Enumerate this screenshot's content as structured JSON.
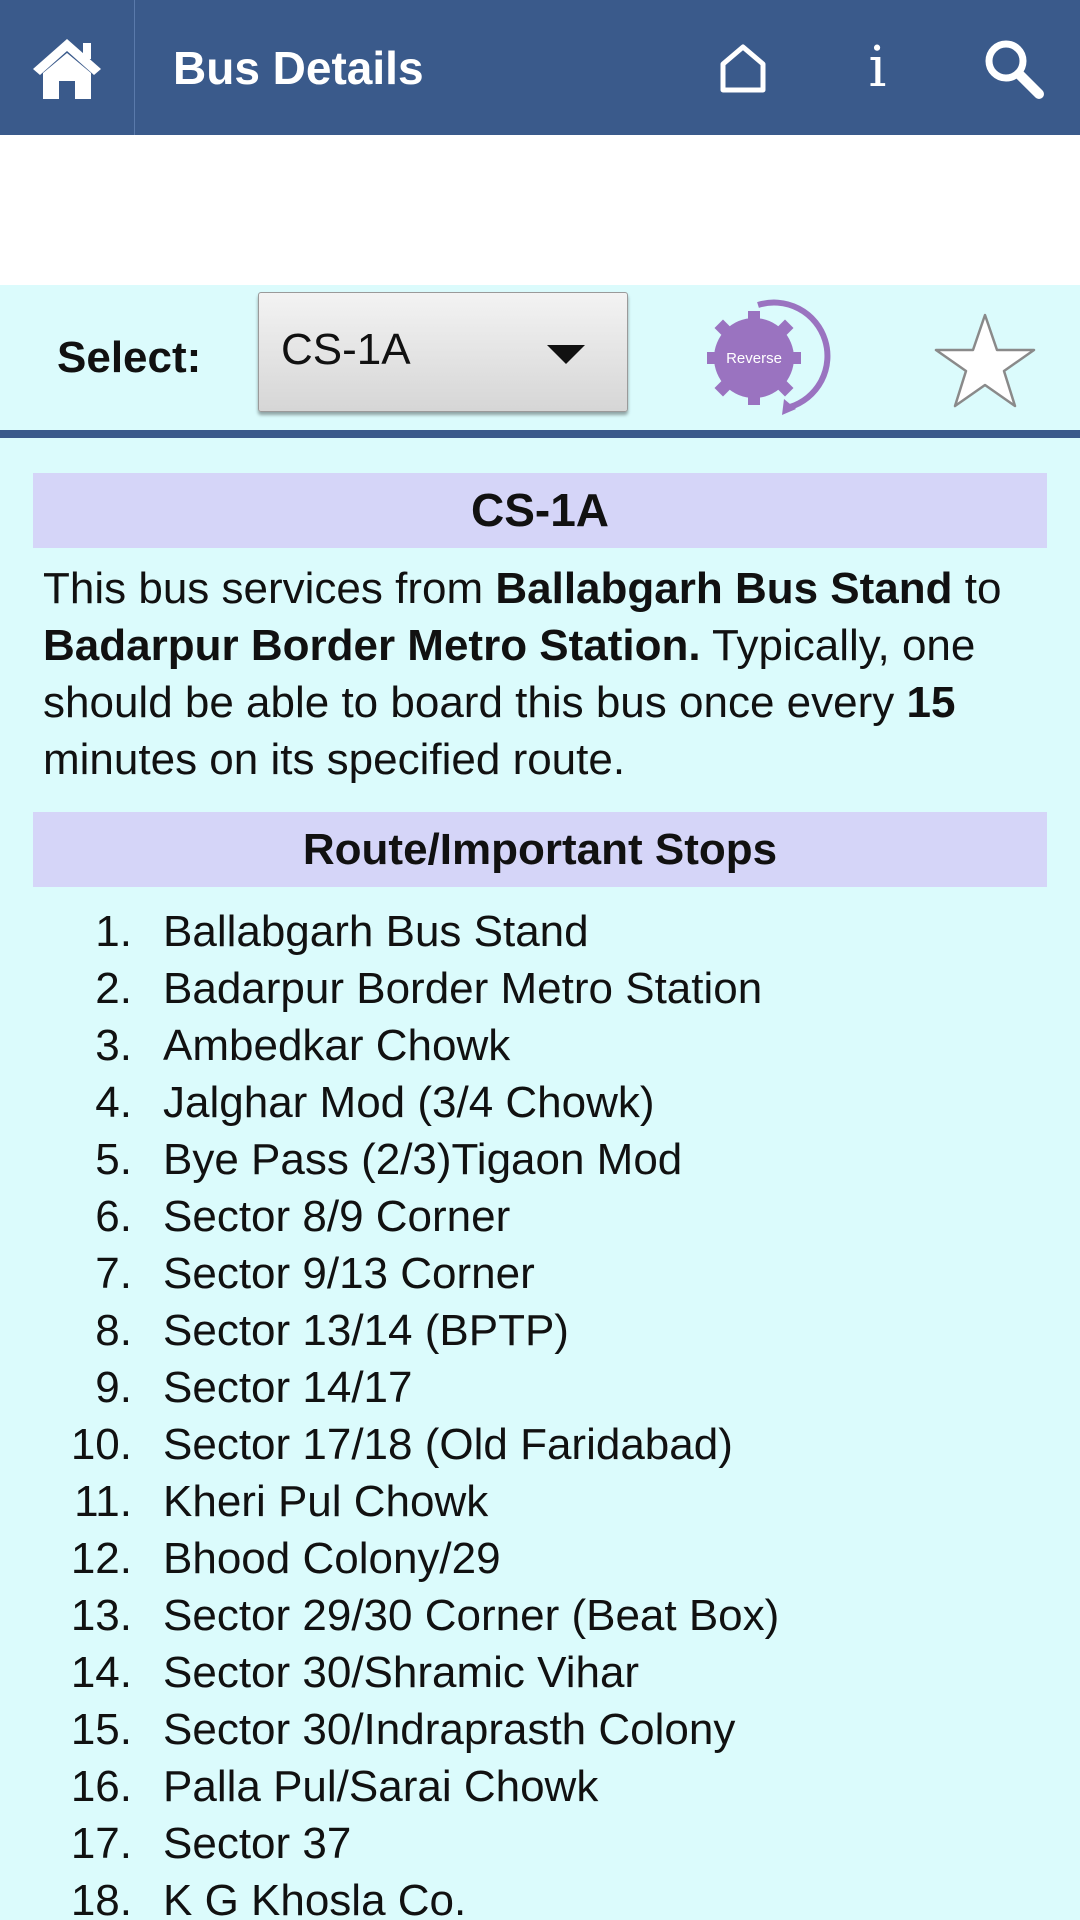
{
  "topbar": {
    "title": "Bus Details",
    "icons": [
      "home-icon",
      "house-outline-icon",
      "info-icon",
      "search-icon"
    ],
    "info_glyph": "i"
  },
  "selector": {
    "label": "Select:",
    "value": "CS-1A",
    "reverse_label": "Reverse"
  },
  "route": {
    "title": "CS-1A",
    "desc": {
      "p1": "This bus services from ",
      "from": "Ballabgarh Bus Stand",
      "p2": " to ",
      "to": "Badarpur Border Metro Station.",
      "p3": " Typically, one should be able to board this bus once every ",
      "freq": "15",
      "p4": " minutes on its specified route."
    },
    "stops_header": "Route/Important Stops",
    "stops": [
      {
        "num": "1.",
        "name": "Ballabgarh Bus Stand"
      },
      {
        "num": "2.",
        "name": "Badarpur Border Metro Station"
      },
      {
        "num": "3.",
        "name": "Ambedkar Chowk"
      },
      {
        "num": "4.",
        "name": "Jalghar Mod (3/4 Chowk)"
      },
      {
        "num": "5.",
        "name": "Bye Pass (2/3)Tigaon Mod"
      },
      {
        "num": "6.",
        "name": "Sector 8/9 Corner"
      },
      {
        "num": "7.",
        "name": "Sector 9/13 Corner"
      },
      {
        "num": "8.",
        "name": "Sector 13/14 (BPTP)"
      },
      {
        "num": "9.",
        "name": "Sector 14/17"
      },
      {
        "num": "10.",
        "name": "Sector 17/18 (Old Faridabad)"
      },
      {
        "num": "11.",
        "name": "Kheri Pul Chowk"
      },
      {
        "num": "12.",
        "name": "Bhood Colony/29"
      },
      {
        "num": "13.",
        "name": "Sector 29/30 Corner (Beat Box)"
      },
      {
        "num": "14.",
        "name": "Sector 30/Shramic Vihar"
      },
      {
        "num": "15.",
        "name": "Sector 30/Indraprasth Colony"
      },
      {
        "num": "16.",
        "name": "Palla Pul/Sarai Chowk"
      },
      {
        "num": "17.",
        "name": "Sector 37"
      },
      {
        "num": "18.",
        "name": "K G Khosla Co."
      }
    ]
  },
  "colors": {
    "topbar": "#3a5a8b",
    "background": "#dbfbfc",
    "header_box": "#d5d5f8",
    "reverse_badge": "#9a73c0"
  }
}
